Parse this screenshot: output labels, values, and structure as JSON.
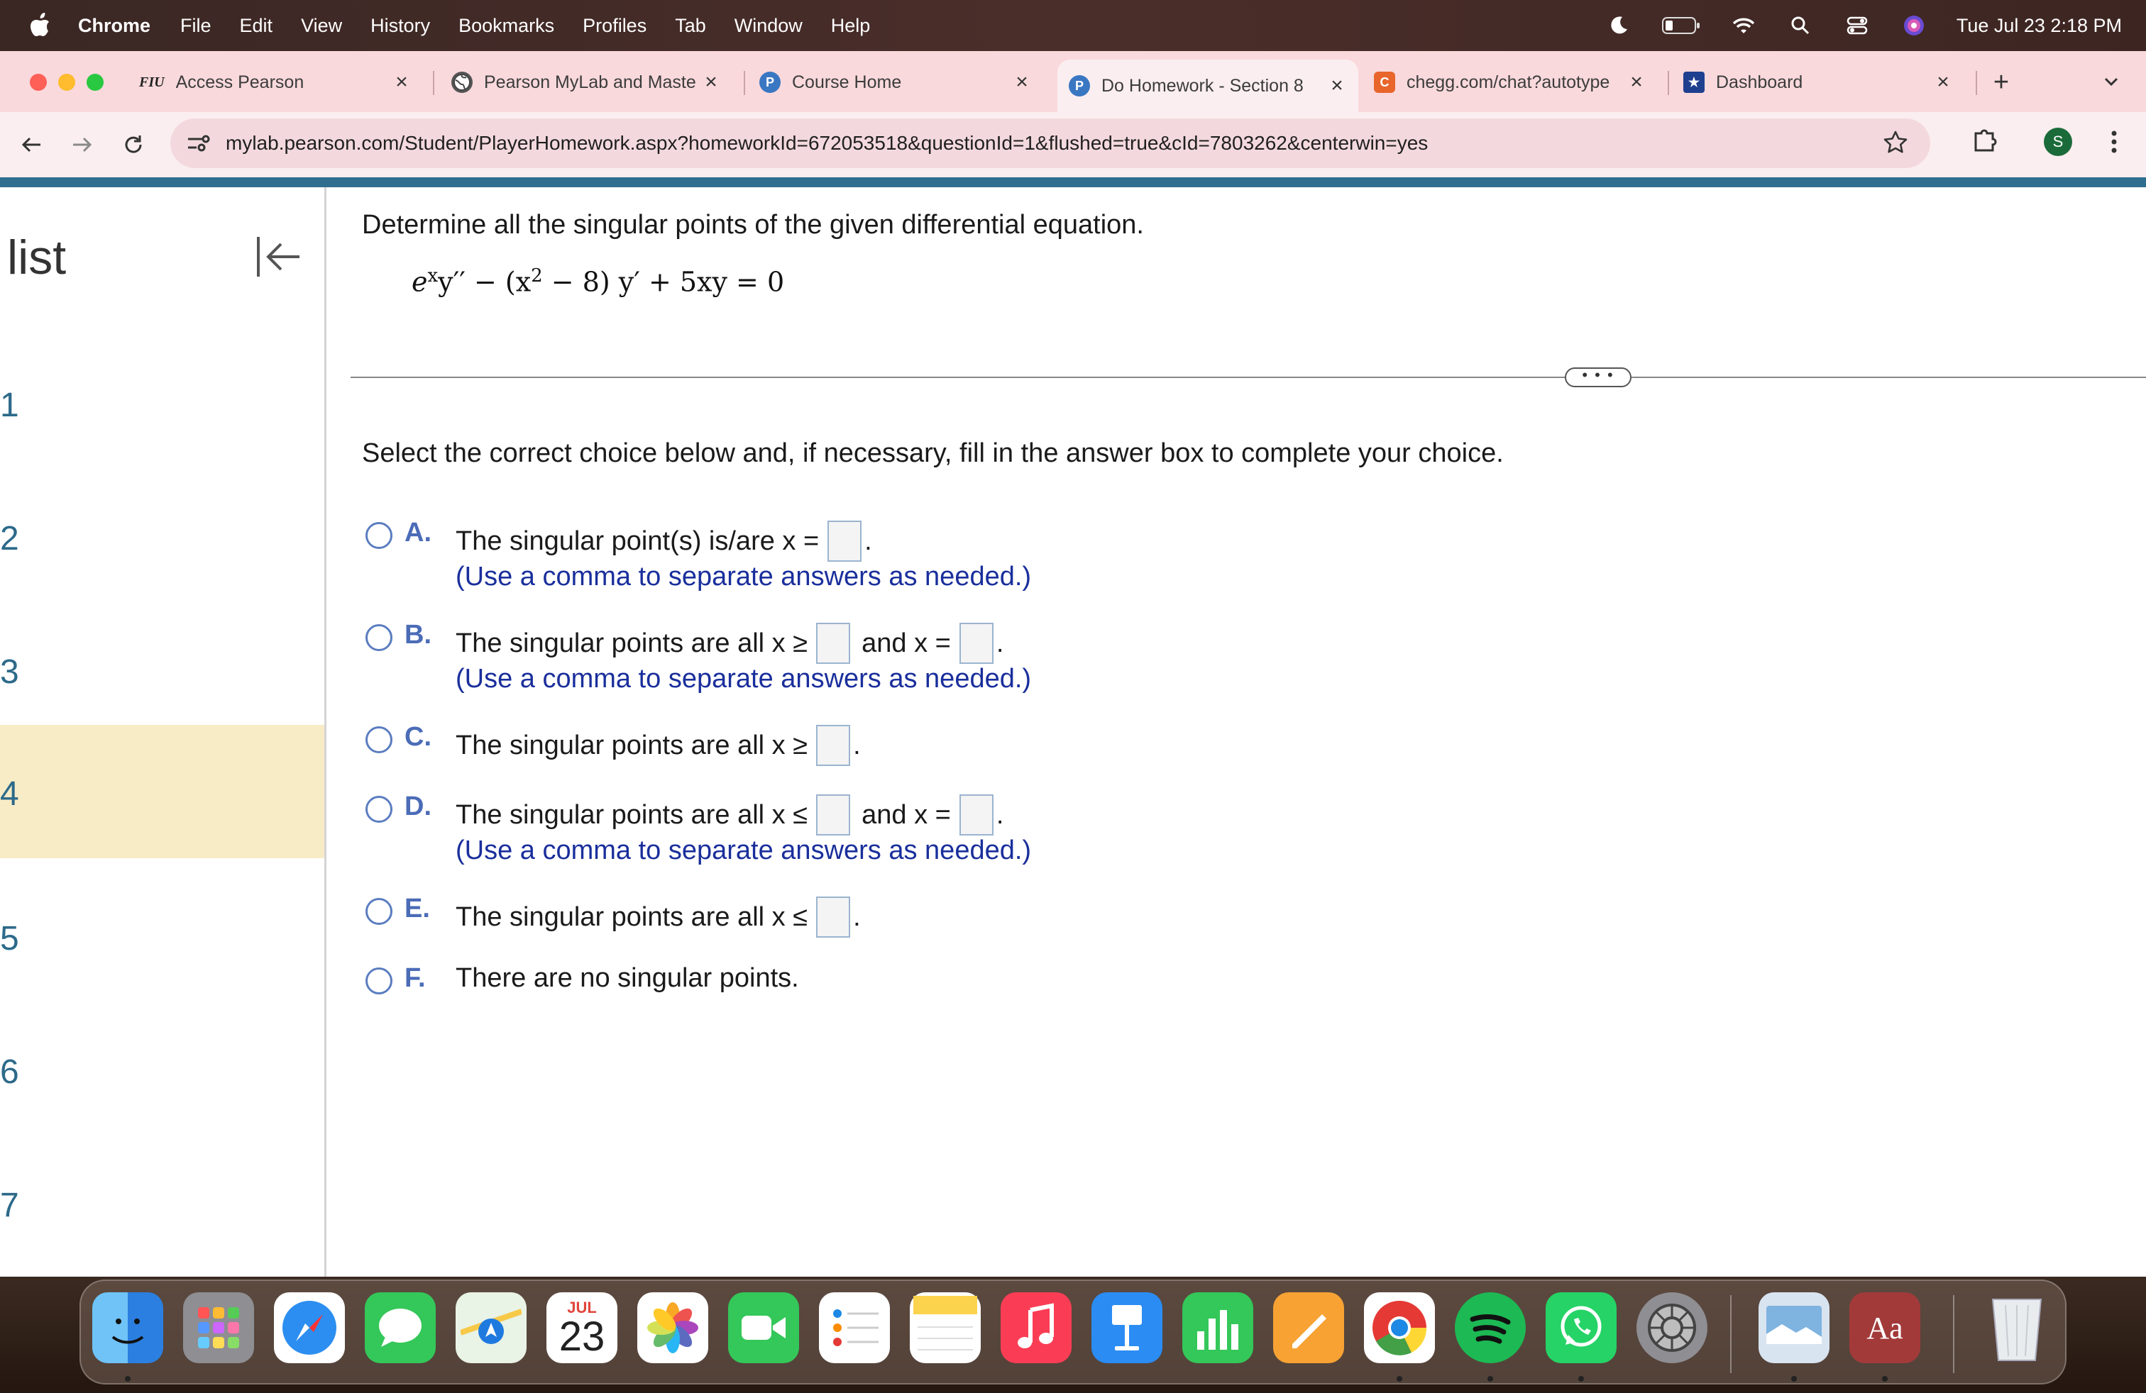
{
  "menubar": {
    "app": "Chrome",
    "items": [
      "File",
      "Edit",
      "View",
      "History",
      "Bookmarks",
      "Profiles",
      "Tab",
      "Window",
      "Help"
    ],
    "clock": "Tue Jul 23  2:18 PM"
  },
  "tabs": [
    {
      "label": "Access Pearson",
      "favicon_text": "FIU"
    },
    {
      "label": "Pearson MyLab and Maste"
    },
    {
      "label": "Course Home"
    },
    {
      "label": "Do Homework - Section 8"
    },
    {
      "label": "chegg.com/chat?autotype"
    },
    {
      "label": "Dashboard"
    }
  ],
  "toolbar": {
    "url": "mylab.pearson.com/Student/PlayerHomework.aspx?homeworkId=672053518&questionId=1&flushed=true&cId=7803262&centerwin=yes",
    "profile_initial": "S"
  },
  "sidebar": {
    "heading": "list",
    "questions": [
      "1",
      "2",
      "3",
      "4",
      "5",
      "6",
      "7"
    ],
    "current_question": "4"
  },
  "question": {
    "prompt": "Determine all the singular points of the given differential equation.",
    "equation": {
      "e": "e",
      "x_sup": "x",
      "part1": "y′′ − (x",
      "sq": "2",
      "part2": " − 8) y′ + 5xy = 0"
    },
    "handle": "• • •",
    "instruction": "Select the correct choice below and, if necessary, fill in the answer box to complete your choice."
  },
  "choices": [
    {
      "letter": "A.",
      "text1": "The singular point(s) is/are x =",
      "text2": ".",
      "hint": "(Use a comma to separate answers as needed.)"
    },
    {
      "letter": "B.",
      "text1": "The singular points are all x ≥",
      "mid": "and x =",
      "text2": ".",
      "hint": "(Use a comma to separate answers as needed.)"
    },
    {
      "letter": "C.",
      "text1": "The singular points are all x ≥",
      "text2": "."
    },
    {
      "letter": "D.",
      "text1": "The singular points are all x ≤",
      "mid": "and x =",
      "text2": ".",
      "hint": "(Use a comma to separate answers as needed.)"
    },
    {
      "letter": "E.",
      "text1": "The singular points are all x ≤",
      "text2": "."
    },
    {
      "letter": "F.",
      "text1": "There are no singular points."
    }
  ],
  "dock": {
    "calendar_month": "JUL",
    "calendar_day": "23",
    "dictionary_label": "Aa"
  },
  "colors": {
    "tabstrip": "#f9d9dc",
    "accent_rule": "#2f6e8e",
    "choice_letter": "#4b6cb7",
    "hint_text": "#1a2f9c",
    "current_question_bg": "#f8ecc7"
  }
}
